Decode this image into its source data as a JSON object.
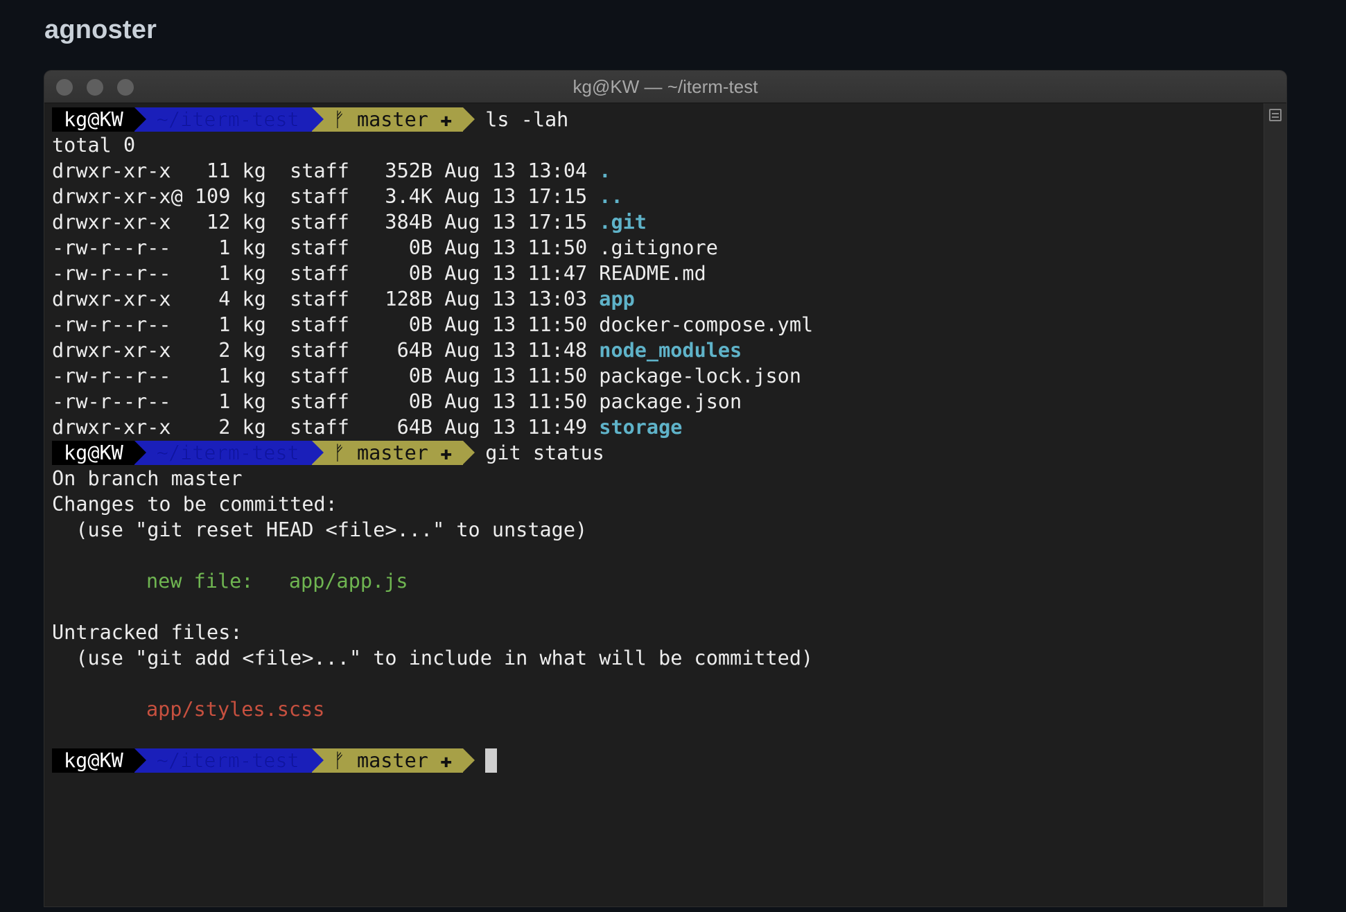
{
  "page_heading": "agnoster",
  "window": {
    "title": "kg@KW — ~/iterm-test"
  },
  "prompt": {
    "user": "kg@KW",
    "dir": "~/iterm-test",
    "branch": "ᚠ master ✚"
  },
  "commands": {
    "first": "ls -lah",
    "second": "git status"
  },
  "ls": {
    "total": "total 0",
    "rows": [
      {
        "meta": "drwxr-xr-x   11 kg  staff   352B Aug 13 13:04 ",
        "name": ".",
        "kind": "dot"
      },
      {
        "meta": "drwxr-xr-x@ 109 kg  staff   3.4K Aug 13 17:15 ",
        "name": "..",
        "kind": "dot"
      },
      {
        "meta": "drwxr-xr-x   12 kg  staff   384B Aug 13 17:15 ",
        "name": ".git",
        "kind": "dir"
      },
      {
        "meta": "-rw-r--r--    1 kg  staff     0B Aug 13 11:50 ",
        "name": ".gitignore",
        "kind": "file"
      },
      {
        "meta": "-rw-r--r--    1 kg  staff     0B Aug 13 11:47 ",
        "name": "README.md",
        "kind": "file"
      },
      {
        "meta": "drwxr-xr-x    4 kg  staff   128B Aug 13 13:03 ",
        "name": "app",
        "kind": "dir"
      },
      {
        "meta": "-rw-r--r--    1 kg  staff     0B Aug 13 11:50 ",
        "name": "docker-compose.yml",
        "kind": "file"
      },
      {
        "meta": "drwxr-xr-x    2 kg  staff    64B Aug 13 11:48 ",
        "name": "node_modules",
        "kind": "dir"
      },
      {
        "meta": "-rw-r--r--    1 kg  staff     0B Aug 13 11:50 ",
        "name": "package-lock.json",
        "kind": "file"
      },
      {
        "meta": "-rw-r--r--    1 kg  staff     0B Aug 13 11:50 ",
        "name": "package.json",
        "kind": "file"
      },
      {
        "meta": "drwxr-xr-x    2 kg  staff    64B Aug 13 11:49 ",
        "name": "storage",
        "kind": "dir"
      }
    ]
  },
  "git_status": {
    "branch_line": "On branch master",
    "staged_header": "Changes to be committed:",
    "staged_hint": "  (use \"git reset HEAD <file>...\" to unstage)",
    "staged_file": "new file:   app/app.js",
    "untracked_header": "Untracked files:",
    "untracked_hint": "  (use \"git add <file>...\" to include in what will be committed)",
    "untracked_file": "app/styles.scss"
  },
  "colors": {
    "segment_user": "#000000",
    "segment_dir": "#1a1fba",
    "segment_git": "#a7a047",
    "directory": "#5fb3c9",
    "staged": "#6fb551",
    "untracked": "#c7503f"
  },
  "icons": {
    "branch": "git-branch-icon",
    "dirty": "plus-icon",
    "scroll_control": "scroll-split-icon"
  }
}
